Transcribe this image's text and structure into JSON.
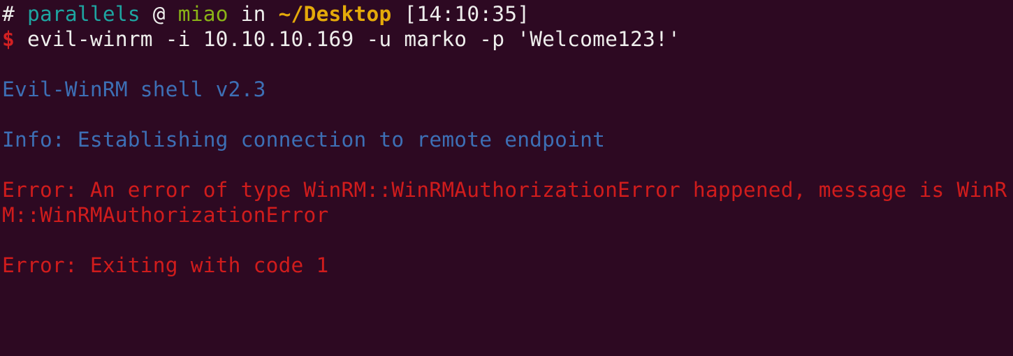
{
  "colors": {
    "background": "#2d0922",
    "foreground": "#eeeeec",
    "user": "#1ea5a1",
    "host": "#8ab317",
    "path": "#e4aa0a",
    "prompt_symbol": "#d32022",
    "info": "#3d6fb5",
    "error": "#d01c1c"
  },
  "prompt": {
    "hash": "#",
    "user": "parallels",
    "at": "@",
    "host": "miao",
    "in": "in",
    "path": "~/Desktop",
    "time": "[14:10:35]",
    "dollar": "$",
    "command": "evil-winrm -i 10.10.10.169 -u marko -p 'Welcome123!'"
  },
  "output": {
    "banner": "Evil-WinRM shell v2.3",
    "info": "Info: Establishing connection to remote endpoint",
    "error_line1": "Error: An error of type WinRM::WinRMAuthorizationError happened, message is WinR",
    "error_line2": "M::WinRMAuthorizationError",
    "exit": "Error: Exiting with code 1"
  }
}
